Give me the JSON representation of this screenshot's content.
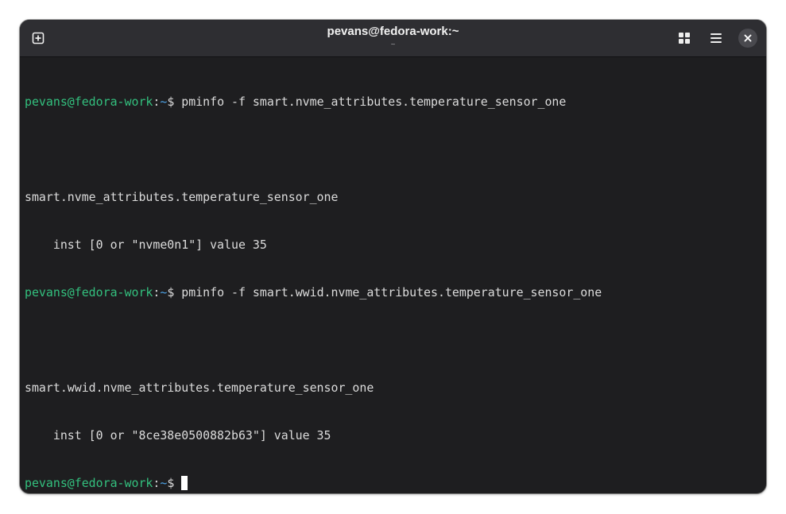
{
  "window": {
    "title": "pevans@fedora-work:~",
    "subtitle": "~"
  },
  "header": {
    "new_tab_icon": "new-tab-icon",
    "tab_overview_icon": "grid-icon",
    "menu_icon": "hamburger-menu-icon",
    "close_icon": "close-icon"
  },
  "colors": {
    "prompt_user": "#33c07e",
    "prompt_path": "#4da3e6",
    "text": "#dcdcdc",
    "background": "#1e1e20",
    "header": "#2e2e32"
  },
  "terminal": {
    "prompt": {
      "user_host": "pevans@fedora-work",
      "separator": ":",
      "path": "~",
      "symbol": "$ "
    },
    "commands": [
      "pminfo -f smart.nvme_attributes.temperature_sensor_one",
      "pminfo -f smart.wwid.nvme_attributes.temperature_sensor_one"
    ],
    "outputs": [
      "smart.nvme_attributes.temperature_sensor_one",
      "    inst [0 or \"nvme0n1\"] value 35",
      "smart.wwid.nvme_attributes.temperature_sensor_one",
      "    inst [0 or \"8ce38e0500882b63\"] value 35"
    ]
  }
}
